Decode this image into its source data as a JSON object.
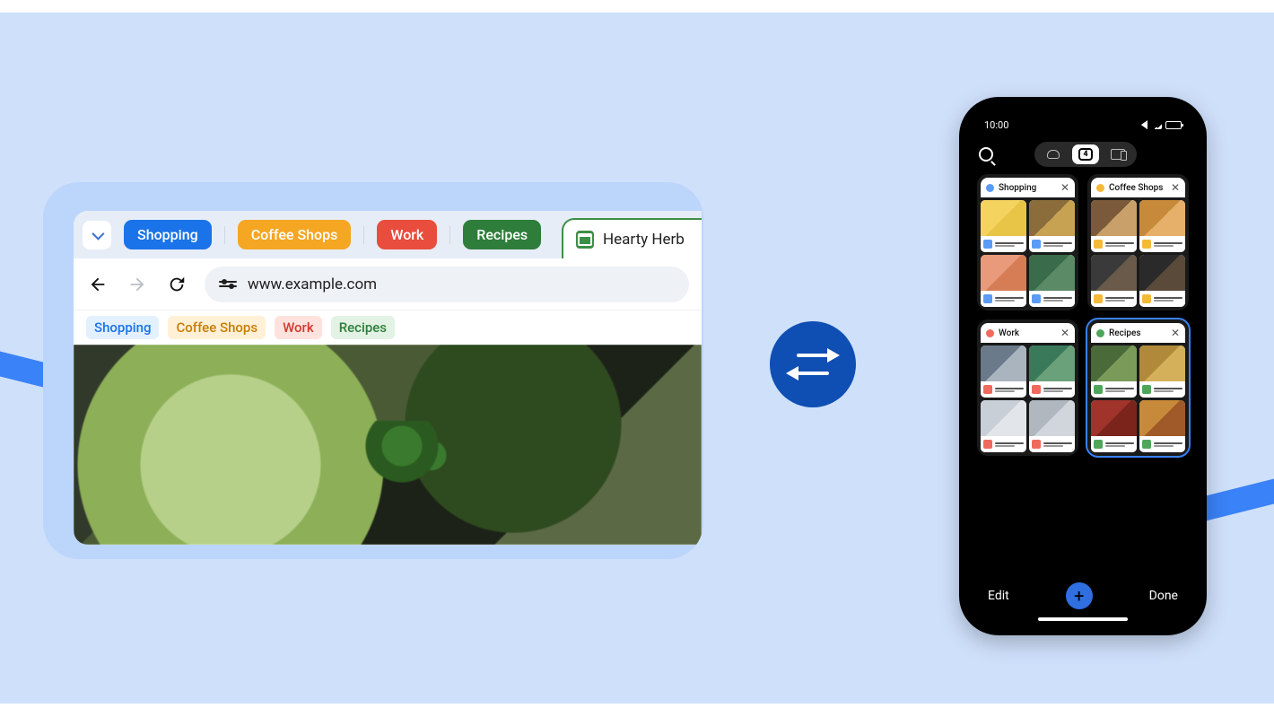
{
  "desktop": {
    "tab_groups": [
      {
        "label": "Shopping",
        "bg": "#1a73e8",
        "fg": "#ffffff",
        "bm_bg": "#e3f0ff",
        "bm_fg": "#1a73e8"
      },
      {
        "label": "Coffee Shops",
        "bg": "#f5a623",
        "fg": "#ffffff",
        "bm_bg": "#fff0d6",
        "bm_fg": "#c77d00"
      },
      {
        "label": "Work",
        "bg": "#e84d3d",
        "fg": "#ffffff",
        "bm_bg": "#ffe2dd",
        "bm_fg": "#d23a2b"
      },
      {
        "label": "Recipes",
        "bg": "#2f7d3b",
        "fg": "#ffffff",
        "bm_bg": "#e2f2e4",
        "bm_fg": "#2f7d3b"
      }
    ],
    "active_tab_title": "Hearty Herb",
    "url": "www.example.com"
  },
  "phone": {
    "time": "10:00",
    "tab_count": "4",
    "groups": [
      {
        "label": "Shopping",
        "dot": "#5a9bf6",
        "selected": false
      },
      {
        "label": "Coffee Shops",
        "dot": "#f5b93a",
        "selected": false
      },
      {
        "label": "Work",
        "dot": "#ef6a5d",
        "selected": false
      },
      {
        "label": "Recipes",
        "dot": "#4fa65a",
        "selected": true
      }
    ],
    "edit_label": "Edit",
    "done_label": "Done"
  },
  "tile_palettes": {
    "Shopping": [
      "#f4d35e,#e8c547",
      "#8a6d3b,#c7a252",
      "#e89a7a,#d77d56",
      "#3a6b4a,#5a8a66"
    ],
    "Coffee Shops": [
      "#7a5a3a,#c9a06a",
      "#c78a3a,#e6b06a",
      "#3a3a3a,#6a5a4a",
      "#2a2a2a,#5a4a3a"
    ],
    "Work": [
      "#6a7a8a,#aab4bf",
      "#3a7a5a,#6aa07a",
      "#c9cfd6,#e2e6ea",
      "#b0b7bf,#d0d6dc"
    ],
    "Recipes": [
      "#4a6a3a,#7a9a5a",
      "#b08a3a,#d4b05a",
      "#a0342a,#7a241c",
      "#c78a3a,#a05a2a"
    ]
  }
}
